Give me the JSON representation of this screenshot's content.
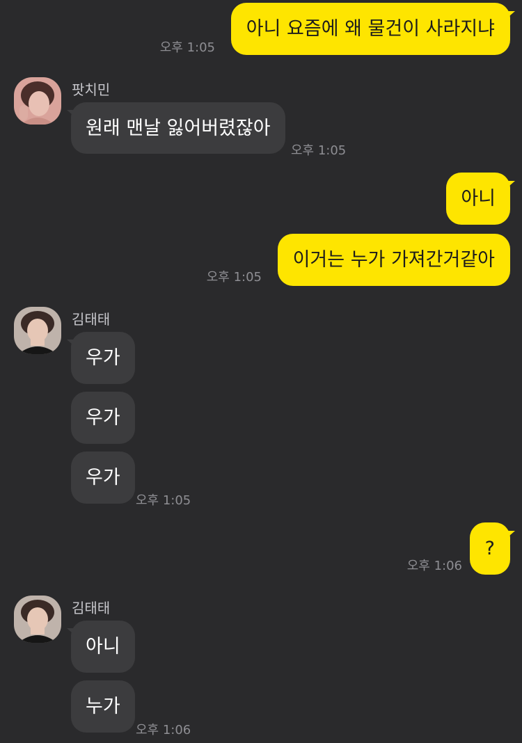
{
  "chat": {
    "messages": [
      {
        "text": "아니 요즘에 왜 물건이 사라지냐",
        "time": "오후 1:05"
      },
      {
        "sender": "팟치민",
        "text": "원래 맨날 잃어버렸잖아",
        "time": "오후 1:05"
      },
      {
        "text": "아니"
      },
      {
        "text": "이거는 누가 가져간거같아",
        "time": "오후 1:05"
      },
      {
        "sender": "김태태",
        "text": "우가"
      },
      {
        "text": "우가"
      },
      {
        "text": "우가",
        "time": "오후 1:05"
      },
      {
        "text": "?",
        "time": "오후 1:06"
      },
      {
        "sender": "김태태",
        "text": "아니"
      },
      {
        "text": "누가",
        "time": "오후 1:06"
      }
    ]
  },
  "colors": {
    "background": "#2a2a2c",
    "outgoing_bubble": "#fee500",
    "incoming_bubble": "#3c3c3e",
    "timestamp": "#8e8e93"
  }
}
